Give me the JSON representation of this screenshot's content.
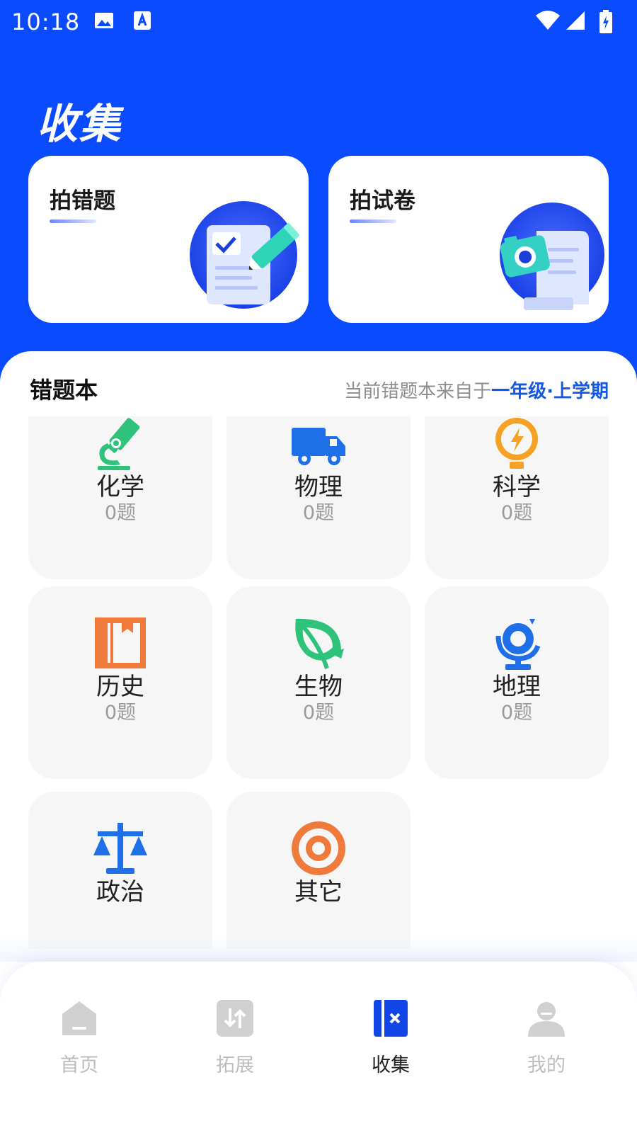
{
  "status_bar": {
    "time": "10:18"
  },
  "header": {
    "title": "收集"
  },
  "actions": [
    {
      "label": "拍错题"
    },
    {
      "label": "拍试卷"
    }
  ],
  "notebook": {
    "title": "错题本",
    "note_prefix": "当前错题本来自于",
    "note_highlight": "一年级·上学期"
  },
  "subjects": [
    {
      "name": "化学",
      "count": "0题",
      "icon": "microscope-icon"
    },
    {
      "name": "物理",
      "count": "0题",
      "icon": "truck-icon"
    },
    {
      "name": "科学",
      "count": "0题",
      "icon": "lightbulb-icon"
    },
    {
      "name": "历史",
      "count": "0题",
      "icon": "book-icon"
    },
    {
      "name": "生物",
      "count": "0题",
      "icon": "leaf-icon"
    },
    {
      "name": "地理",
      "count": "0题",
      "icon": "globe-icon"
    },
    {
      "name": "政治",
      "count": "",
      "icon": "scales-icon"
    },
    {
      "name": "其它",
      "count": "",
      "icon": "target-icon"
    }
  ],
  "tabs": [
    {
      "label": "首页",
      "icon": "home-icon",
      "active": false
    },
    {
      "label": "拓展",
      "icon": "swap-icon",
      "active": false
    },
    {
      "label": "收集",
      "icon": "collect-icon",
      "active": true
    },
    {
      "label": "我的",
      "icon": "profile-icon",
      "active": false
    }
  ],
  "colors": {
    "brand_blue": "#0B4BFF",
    "highlight": "#1558E6",
    "tab_inactive": "#BDBDBD"
  }
}
